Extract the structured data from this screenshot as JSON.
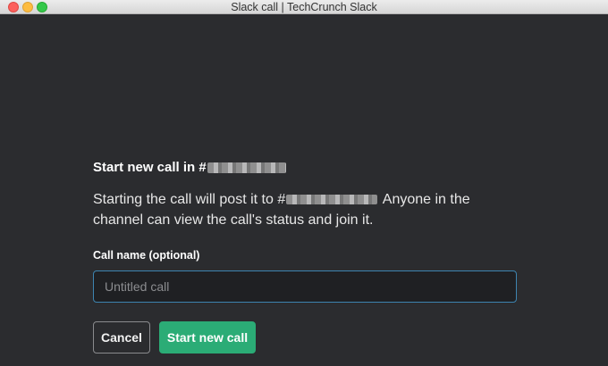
{
  "window": {
    "title": "Slack call | TechCrunch Slack"
  },
  "dialog": {
    "heading_prefix": "Start new call in #",
    "description_prefix": "Starting the call will post it to #",
    "description_suffix": " Anyone in the channel can view the call's status and join it.",
    "field_label": "Call name (optional)",
    "call_name_value": "",
    "call_name_placeholder": "Untitled call",
    "cancel_label": "Cancel",
    "start_label": "Start new call"
  },
  "colors": {
    "background": "#2b2c2f",
    "primary_button": "#2bac76",
    "input_focus_border": "#3d84b0"
  }
}
